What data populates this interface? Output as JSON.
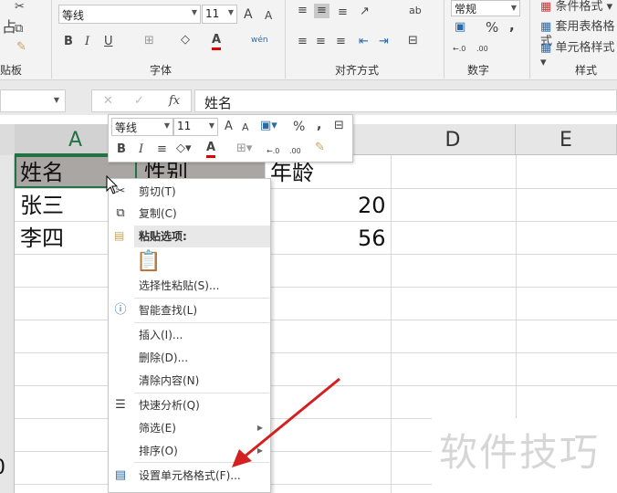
{
  "ribbon": {
    "clipboard": {
      "label": "贴板",
      "paste_char": "占"
    },
    "font": {
      "label": "字体",
      "font_name": "等线",
      "font_size": "11",
      "bold": "B",
      "italic": "I",
      "underline": "U",
      "grow": "A",
      "shrink": "A",
      "font_color": "A",
      "phonetic": "wén"
    },
    "alignment": {
      "label": "对齐方式",
      "wrap": "ab"
    },
    "number": {
      "label": "数字",
      "format": "常规",
      "percent": "%",
      "comma": ",",
      "inc_decimal": "←.0",
      "dec_decimal": ".00"
    },
    "styles": {
      "label": "样式",
      "conditional": "条件格式",
      "table": "套用表格格式",
      "cell_styles": "单元格样式"
    }
  },
  "formula_bar": {
    "cancel": "✕",
    "enter": "✓",
    "fx": "fx",
    "value": "姓名"
  },
  "columns": [
    "A",
    "D",
    "E"
  ],
  "cells": {
    "a1": "姓名",
    "b1": "性别",
    "c1": "年龄",
    "a2": "张三",
    "c2": "20",
    "a3": "李四",
    "c3": "56",
    "partial_row_number": "0"
  },
  "mini_toolbar": {
    "font_name": "等线",
    "font_size": "11",
    "grow": "A",
    "shrink": "A",
    "percent": "%",
    "comma": ",",
    "bold": "B",
    "italic": "I",
    "font_color": "A",
    "inc_decimal": "←.0",
    "dec_decimal": ".00"
  },
  "context_menu": {
    "cut": "剪切(T)",
    "copy": "复制(C)",
    "paste_options": "粘贴选项:",
    "paste_special": "选择性粘贴(S)...",
    "smart_lookup": "智能查找(L)",
    "insert": "插入(I)...",
    "delete": "删除(D)...",
    "clear": "清除内容(N)",
    "quick_analysis": "快速分析(Q)",
    "filter": "筛选(E)",
    "sort": "排序(O)",
    "format_cells": "设置单元格格式(F)..."
  },
  "watermark": "软件技巧",
  "colors": {
    "selection": "#217346",
    "arrow": "#d42020",
    "font_red": "#e00000"
  }
}
